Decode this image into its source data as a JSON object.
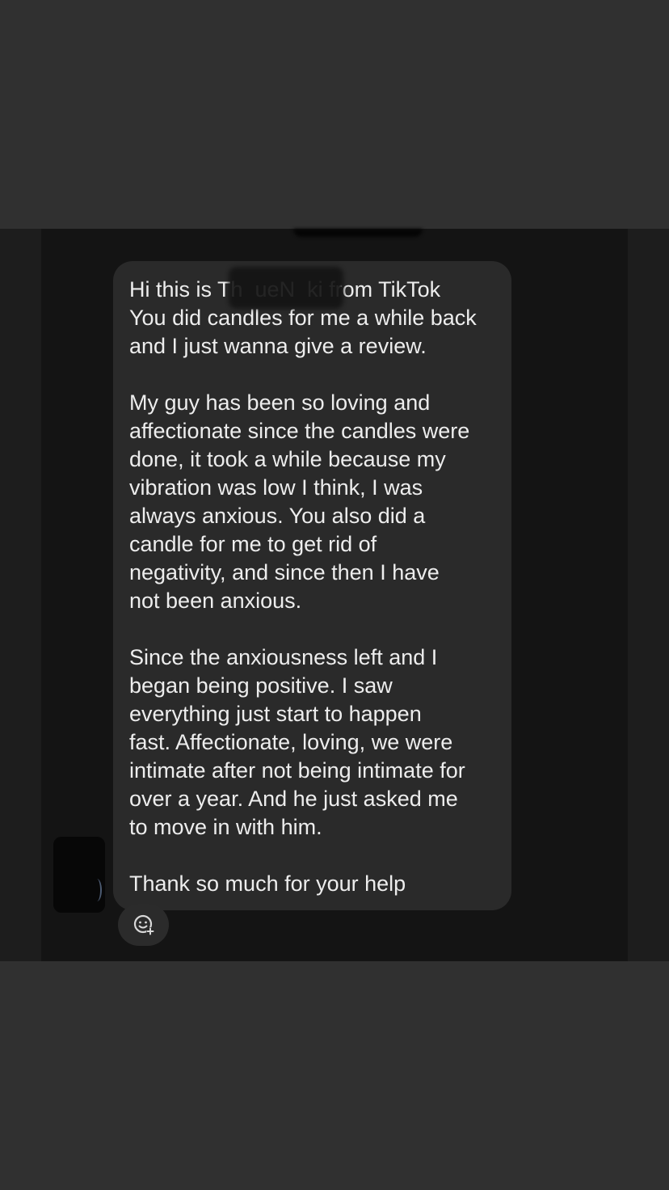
{
  "message": {
    "lines": [
      "Hi this is Th  ueN  ki from TikTok",
      "You did candles for me a while back",
      "and I just wanna give a review.",
      "",
      "My guy has been so loving and",
      "affectionate since the candles were",
      "done, it took a while because my",
      "vibration was low I think, I was",
      "always anxious. You also did a",
      "candle for me to get rid of",
      "negativity, and since then I have",
      "not been anxious.",
      "",
      "Since the anxiousness left and I",
      "began being positive. I saw",
      "everything just start to happen",
      "fast. Affectionate, loving, we were",
      "intimate after not being intimate for",
      "over a year. And he just asked me",
      "to move in with him.",
      "",
      "Thank so much for your help"
    ]
  },
  "react_button": {
    "icon": "add-reaction-icon"
  },
  "colors": {
    "page_background": "#303030",
    "chat_background": "#141414",
    "bubble_background": "#2a2a2a",
    "text": "#ededed"
  }
}
